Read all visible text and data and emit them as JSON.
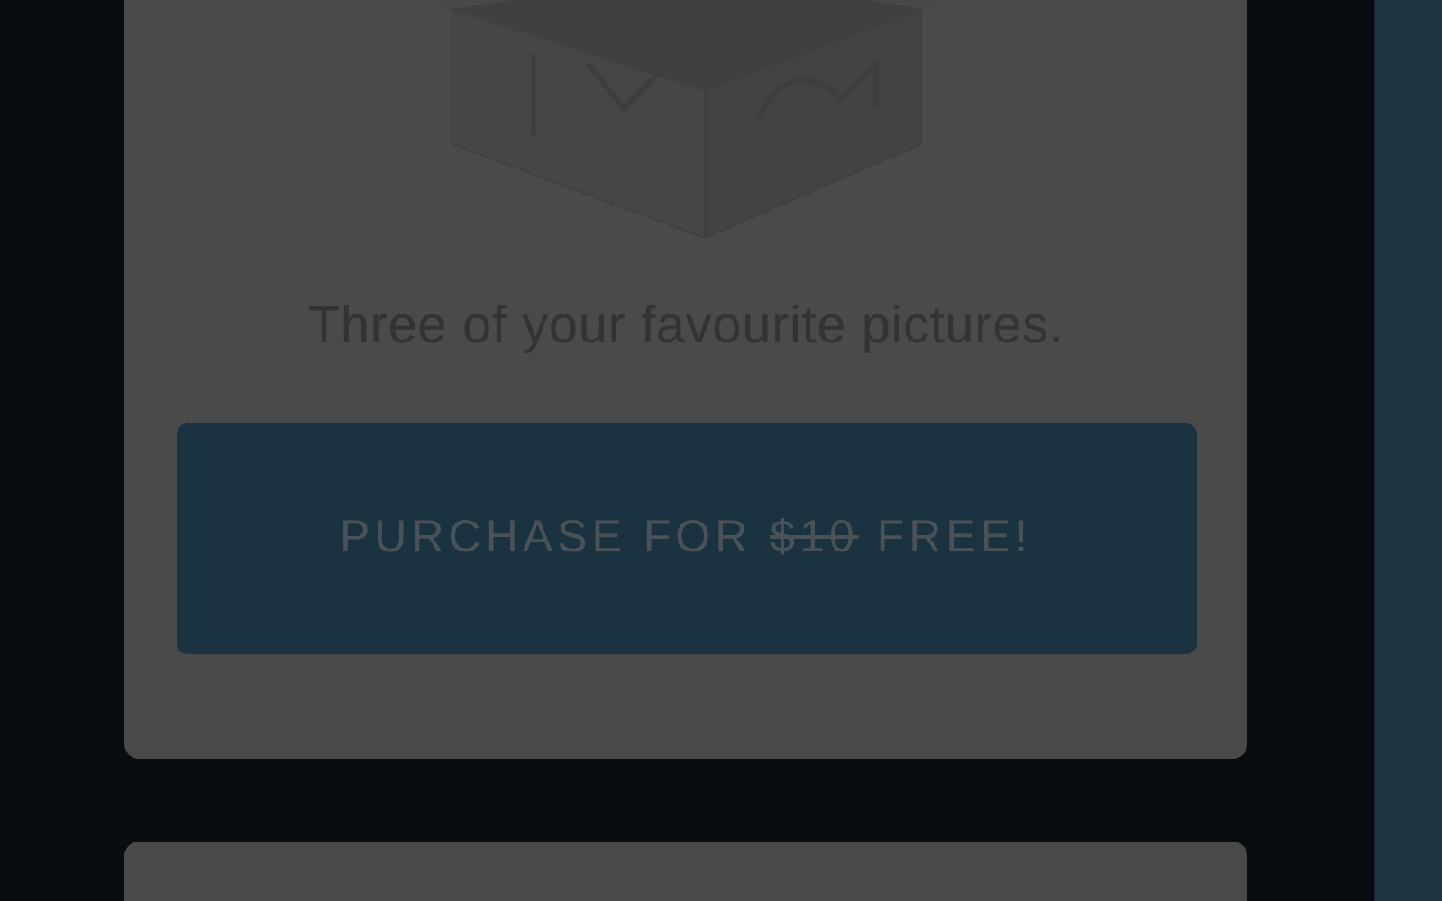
{
  "card": {
    "caption": "Three of your favourite pictures.",
    "button": [
      {
        "text": "PURCHASE FOR",
        "struck": false
      },
      {
        "text": "$10",
        "struck": true
      },
      {
        "text": "FREE!",
        "struck": false
      }
    ]
  }
}
